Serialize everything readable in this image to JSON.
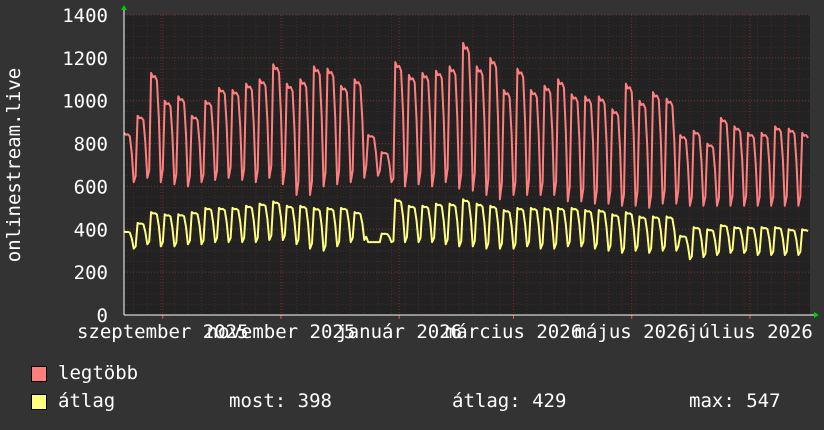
{
  "chart_data": {
    "type": "line",
    "ylabel": "onlinestream.live",
    "ylim": [
      0,
      1400
    ],
    "yticks": [
      0,
      200,
      400,
      600,
      800,
      1000,
      1200,
      1400
    ],
    "xlim": [
      "2025-08-12",
      "2026-08-01"
    ],
    "xticks": [
      {
        "date": "2025-09-01",
        "label": "szeptember 2025"
      },
      {
        "date": "2025-11-01",
        "label": "november 2025"
      },
      {
        "date": "2026-01-01",
        "label": "január 2026"
      },
      {
        "date": "2026-03-01",
        "label": "március 2026"
      },
      {
        "date": "2026-05-01",
        "label": "május 2026"
      },
      {
        "date": "2026-07-01",
        "label": "július 2026"
      }
    ],
    "grid": true,
    "background": "#222222",
    "series": [
      {
        "name": "legtöbb",
        "color": "#ff7f7f",
        "weekly_low": [
          620,
          640,
          620,
          610,
          600,
          620,
          630,
          640,
          630,
          620,
          640,
          610,
          560,
          560,
          600,
          610,
          620,
          640,
          650,
          620,
          600,
          610,
          600,
          620,
          590,
          580,
          560,
          540,
          560,
          560,
          560,
          560,
          530,
          530,
          520,
          520,
          510,
          510,
          500,
          520,
          520,
          510,
          510,
          510,
          510,
          510,
          510,
          510,
          510,
          510,
          510
        ],
        "weekly_high": [
          850,
          930,
          1130,
          1000,
          1020,
          930,
          1000,
          1060,
          1050,
          1080,
          1100,
          1170,
          1080,
          1100,
          1160,
          1150,
          1070,
          1100,
          840,
          760,
          1180,
          1120,
          1130,
          1140,
          1160,
          1270,
          1160,
          1200,
          1050,
          1150,
          1050,
          1070,
          1100,
          1030,
          1020,
          1020,
          960,
          1080,
          1000,
          1040,
          1010,
          840,
          860,
          800,
          920,
          880,
          850,
          850,
          880,
          870,
          850
        ]
      },
      {
        "name": "átlag",
        "color": "#ffff7f",
        "weekly_low": [
          310,
          330,
          320,
          320,
          330,
          330,
          340,
          340,
          340,
          340,
          350,
          350,
          330,
          310,
          300,
          320,
          340,
          350,
          340,
          340,
          340,
          340,
          340,
          330,
          320,
          320,
          310,
          310,
          310,
          320,
          310,
          310,
          320,
          320,
          310,
          300,
          290,
          300,
          290,
          300,
          300,
          260,
          270,
          280,
          290,
          290,
          280,
          280,
          280,
          280,
          280
        ],
        "weekly_high": [
          390,
          430,
          480,
          470,
          470,
          480,
          500,
          500,
          500,
          510,
          520,
          530,
          510,
          510,
          500,
          500,
          500,
          480,
          340,
          380,
          540,
          510,
          510,
          520,
          520,
          540,
          520,
          510,
          490,
          500,
          500,
          500,
          500,
          500,
          490,
          490,
          470,
          480,
          460,
          460,
          460,
          370,
          410,
          400,
          420,
          410,
          410,
          410,
          410,
          400,
          400
        ]
      }
    ]
  },
  "legend": [
    {
      "label": "legtöbb",
      "color": "#ff7f7f"
    },
    {
      "label": "átlag",
      "color": "#ffff7f"
    }
  ],
  "stats": {
    "now": "most: 398",
    "avg": "átlag: 429",
    "max": "max: 547"
  }
}
